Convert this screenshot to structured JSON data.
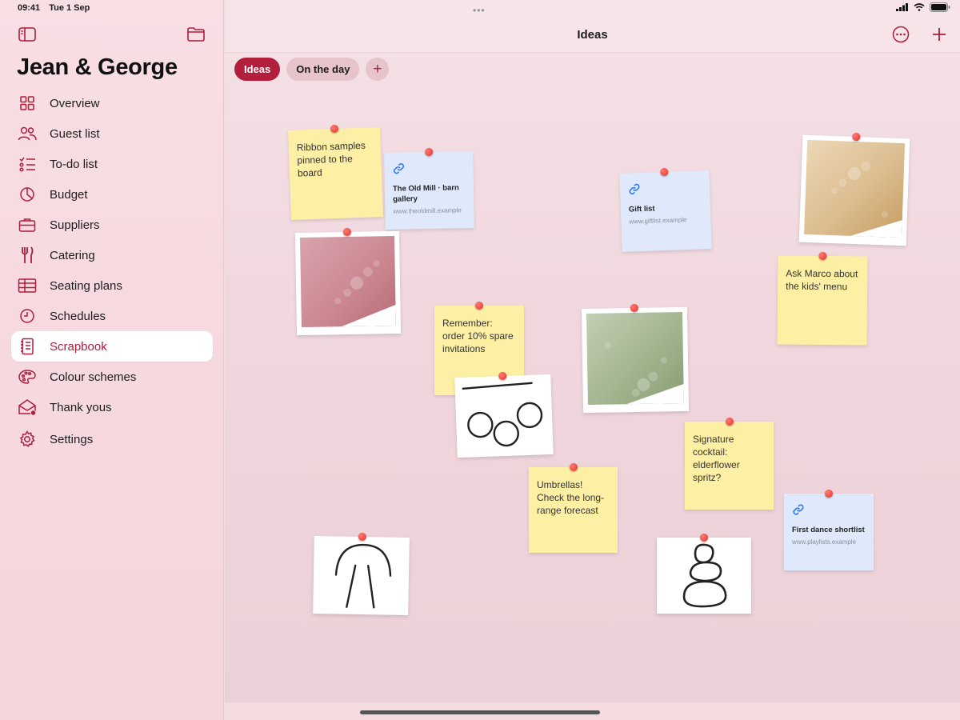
{
  "status": {
    "time": "09:41",
    "date": "Tue 1 Sep"
  },
  "sidebar": {
    "title": "Jean & George",
    "items": [
      {
        "label": "Overview",
        "icon": "grid-icon"
      },
      {
        "label": "Guest list",
        "icon": "people-icon"
      },
      {
        "label": "To-do list",
        "icon": "checklist-icon"
      },
      {
        "label": "Budget",
        "icon": "pie-chart-icon"
      },
      {
        "label": "Suppliers",
        "icon": "briefcase-icon"
      },
      {
        "label": "Catering",
        "icon": "fork-knife-icon"
      },
      {
        "label": "Seating plans",
        "icon": "table-icon"
      },
      {
        "label": "Schedules",
        "icon": "clock-icon"
      },
      {
        "label": "Scrapbook",
        "icon": "notebook-icon",
        "active": true
      },
      {
        "label": "Colour schemes",
        "icon": "palette-icon"
      },
      {
        "label": "Thank yous",
        "icon": "envelope-icon"
      },
      {
        "label": "Settings",
        "icon": "gear-icon"
      }
    ]
  },
  "header": {
    "title": "Ideas"
  },
  "tabs": [
    {
      "label": "Ideas",
      "active": true
    },
    {
      "label": "On the day",
      "active": false
    }
  ],
  "board": {
    "notes": [
      {
        "id": "ribbon",
        "text": "Ribbon samples pinned to the board"
      },
      {
        "id": "remember",
        "text": "Remember: order 10% spare invitations"
      },
      {
        "id": "marco",
        "text": "Ask Marco about the kids' menu"
      },
      {
        "id": "cocktail",
        "text": "Signature cocktail: elderflower spritz?"
      },
      {
        "id": "umbrellas",
        "text": "Umbrellas! Check the long-range forecast"
      }
    ],
    "links": [
      {
        "id": "oldmill",
        "title": "The Old Mill · barn gallery",
        "url": "www.theoldmill.example"
      },
      {
        "id": "gift",
        "title": "Gift list",
        "url": "www.giftlist.example"
      },
      {
        "id": "dance",
        "title": "First dance shortlist",
        "url": "www.playlists.example"
      }
    ]
  },
  "colors": {
    "accent": "#b11f3c",
    "sticky": "#fdf0a4",
    "link_card": "#dfe9fb",
    "pin": "#e0302a",
    "link_icon": "#2f7bf6"
  }
}
